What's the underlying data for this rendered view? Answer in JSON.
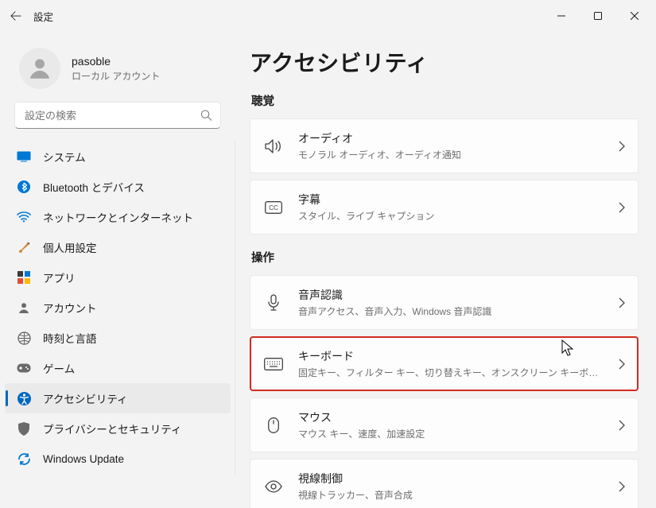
{
  "titlebar": {
    "title": "設定"
  },
  "account": {
    "name": "pasoble",
    "type": "ローカル アカウント"
  },
  "search": {
    "placeholder": "設定の検索"
  },
  "nav": {
    "items": [
      {
        "label": "システム"
      },
      {
        "label": "Bluetooth とデバイス"
      },
      {
        "label": "ネットワークとインターネット"
      },
      {
        "label": "個人用設定"
      },
      {
        "label": "アプリ"
      },
      {
        "label": "アカウント"
      },
      {
        "label": "時刻と言語"
      },
      {
        "label": "ゲーム"
      },
      {
        "label": "アクセシビリティ"
      },
      {
        "label": "プライバシーとセキュリティ"
      },
      {
        "label": "Windows Update"
      }
    ],
    "active_index": 8
  },
  "page": {
    "title": "アクセシビリティ",
    "sections": [
      {
        "label": "聴覚",
        "cards": [
          {
            "title": "オーディオ",
            "sub": "モノラル オーディオ、オーディオ通知"
          },
          {
            "title": "字幕",
            "sub": "スタイル、ライブ キャプション"
          }
        ]
      },
      {
        "label": "操作",
        "cards": [
          {
            "title": "音声認識",
            "sub": "音声アクセス、音声入力、Windows 音声認識"
          },
          {
            "title": "キーボード",
            "sub": "固定キー、フィルター キー、切り替えキー、オンスクリーン キーボード",
            "highlight": true
          },
          {
            "title": "マウス",
            "sub": "マウス キー、速度、加速設定"
          },
          {
            "title": "視線制御",
            "sub": "視線トラッカー、音声合成"
          }
        ]
      }
    ]
  },
  "colors": {
    "accent": "#0067c0",
    "highlight_border": "#d12b1f"
  }
}
